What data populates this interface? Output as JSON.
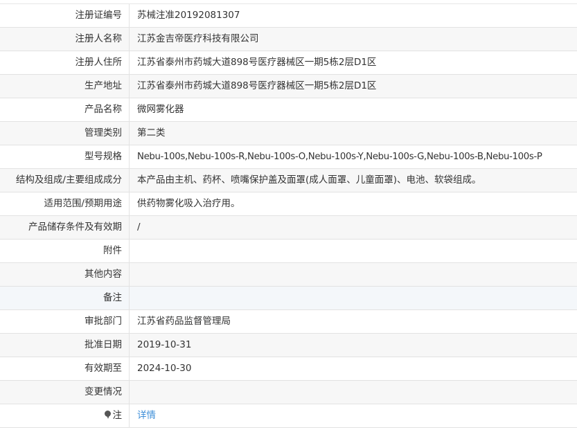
{
  "rows": [
    {
      "label": "注册证编号",
      "value": "苏械注准20192081307"
    },
    {
      "label": "注册人名称",
      "value": "江苏金吉帝医疗科技有限公司"
    },
    {
      "label": "注册人住所",
      "value": "江苏省泰州市药城大道898号医疗器械区一期5栋2层D1区"
    },
    {
      "label": "生产地址",
      "value": "江苏省泰州市药城大道898号医疗器械区一期5栋2层D1区"
    },
    {
      "label": "产品名称",
      "value": "微网雾化器"
    },
    {
      "label": "管理类别",
      "value": "第二类"
    },
    {
      "label": "型号规格",
      "value": "Nebu-100s,Nebu-100s-R,Nebu-100s-O,Nebu-100s-Y,Nebu-100s-G,Nebu-100s-B,Nebu-100s-P"
    },
    {
      "label": "结构及组成/主要组成成分",
      "value": "本产品由主机、药杯、喷嘴保护盖及面罩(成人面罩、儿童面罩)、电池、软袋组成。"
    },
    {
      "label": "适用范围/预期用途",
      "value": "供药物雾化吸入治疗用。"
    },
    {
      "label": "产品储存条件及有效期",
      "value": "/"
    },
    {
      "label": "附件",
      "value": ""
    },
    {
      "label": "其他内容",
      "value": ""
    },
    {
      "label": "备注",
      "value": ""
    },
    {
      "label": "审批部门",
      "value": "江苏省药品监督管理局"
    },
    {
      "label": "批准日期",
      "value": "2019-10-31"
    },
    {
      "label": "有效期至",
      "value": "2024-10-30"
    },
    {
      "label": "变更情况",
      "value": ""
    }
  ],
  "note_row": {
    "label": "注",
    "icon": "pin-icon",
    "link_text": "详情"
  },
  "colors": {
    "link": "#3f8fd8",
    "border": "#e2e2e2",
    "alt_row": "#f7f7f7"
  }
}
